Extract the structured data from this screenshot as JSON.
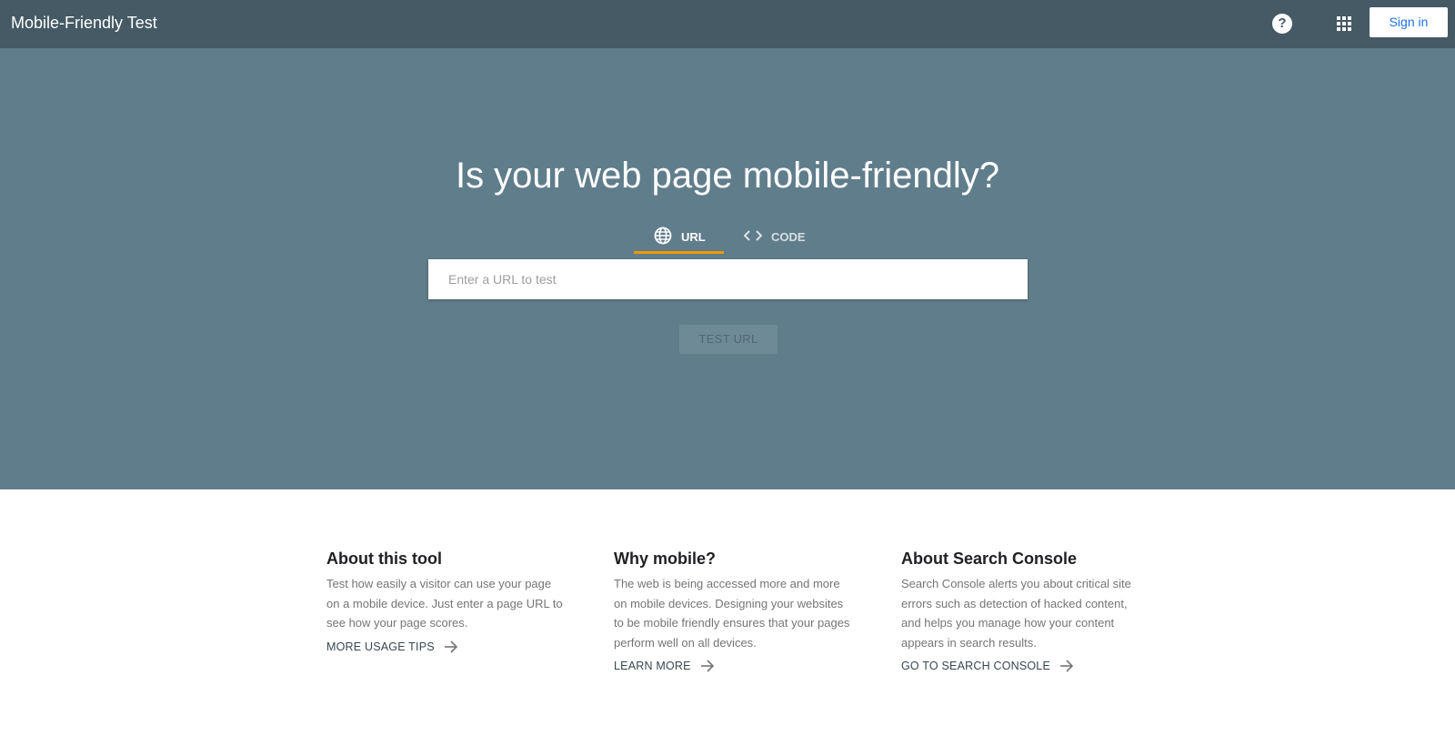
{
  "header": {
    "app_title": "Mobile-Friendly Test",
    "help_glyph": "?",
    "help_icon": "help-circle-icon",
    "apps_icon": "apps-grid-icon",
    "signin_label": "Sign in",
    "bg_color": "#455a64"
  },
  "hero": {
    "heading": "Is your web page mobile-friendly?",
    "bg_color": "#607d8b",
    "tabs": [
      {
        "label": "URL",
        "icon": "globe-icon",
        "active": true
      },
      {
        "label": "CODE",
        "icon": "code-icon",
        "active": false
      }
    ],
    "active_tab_indicator_color": "#f29900",
    "url_input": {
      "value": "",
      "placeholder": "Enter a URL to test"
    },
    "test_button_label": "TEST URL"
  },
  "info": [
    {
      "title": "About this tool",
      "body": "Test how easily a visitor can use your page on a mobile device. Just enter a page URL to see how your page scores.",
      "link_label": "MORE USAGE TIPS",
      "link_icon": "arrow-right-icon"
    },
    {
      "title": "Why mobile?",
      "body": "The web is being accessed more and more on mobile devices. Designing your websites to be mobile friendly ensures that your pages perform well on all devices.",
      "link_label": "LEARN MORE",
      "link_icon": "arrow-right-icon"
    },
    {
      "title": "About Search Console",
      "body": "Search Console alerts you about critical site errors such as detection of hacked content, and helps you manage how your content appears in search results.",
      "link_label": "GO TO SEARCH CONSOLE",
      "link_icon": "arrow-right-icon"
    }
  ]
}
